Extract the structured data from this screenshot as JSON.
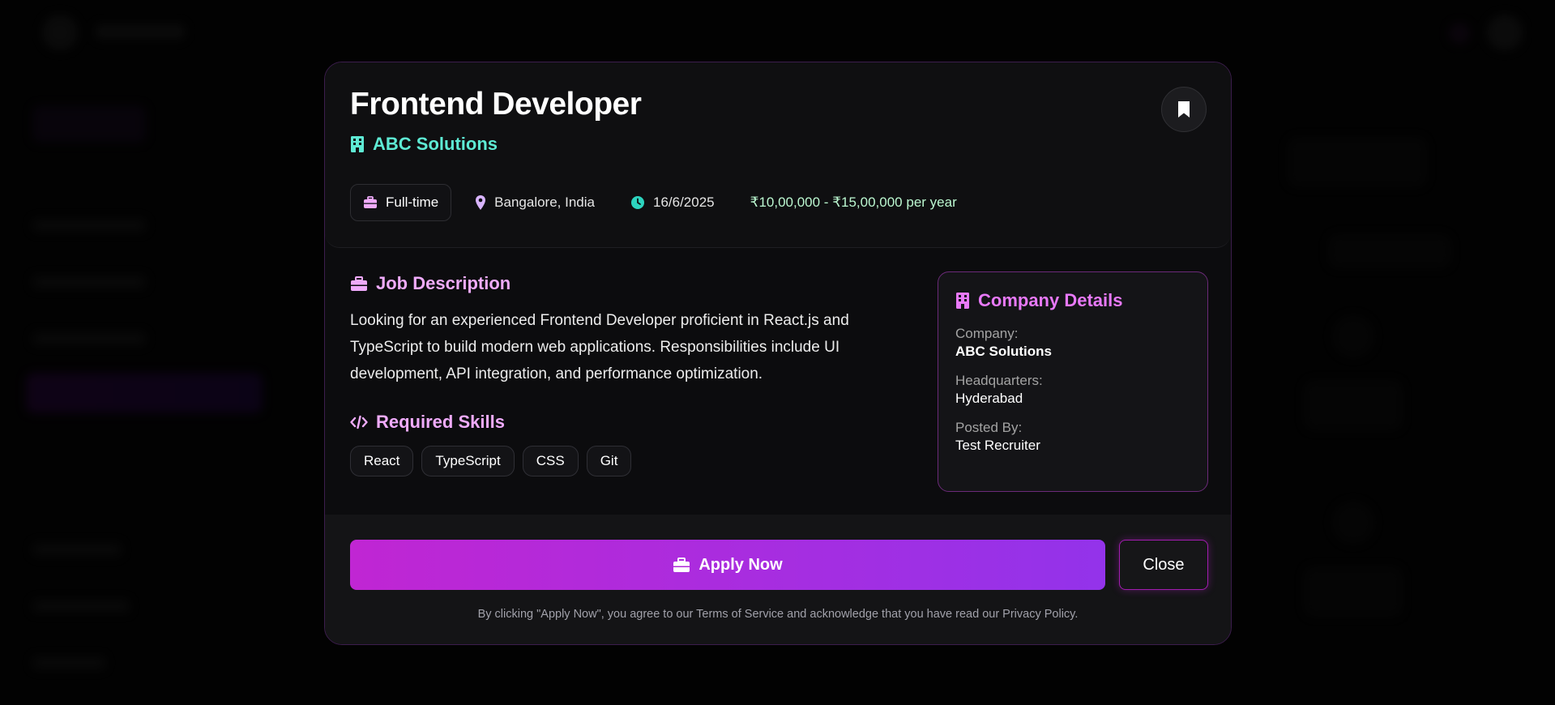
{
  "job": {
    "title": "Frontend Developer",
    "company": "ABC Solutions"
  },
  "meta": {
    "type": "Full-time",
    "location": "Bangalore, India",
    "date": "16/6/2025",
    "salary": "₹10,00,000 - ₹15,00,000 per year"
  },
  "description": {
    "heading": "Job Description",
    "text": "Looking for an experienced Frontend Developer proficient in React.js and TypeScript to build modern web applications. Responsibilities include UI development, API integration, and performance optimization."
  },
  "skills": {
    "heading": "Required Skills",
    "items": [
      "React",
      "TypeScript",
      "CSS",
      "Git"
    ]
  },
  "company_details": {
    "heading": "Company Details",
    "company_label": "Company:",
    "company_value": "ABC Solutions",
    "hq_label": "Headquarters:",
    "hq_value": "Hyderabad",
    "posted_label": "Posted By:",
    "posted_value": "Test Recruiter"
  },
  "footer": {
    "apply_label": "Apply Now",
    "close_label": "Close",
    "disclaimer": "By clicking \"Apply Now\", you agree to our Terms of Service and acknowledge that you have read our Privacy Policy."
  },
  "icons": {
    "bookmark": "bookmark-icon",
    "building": "building-icon",
    "briefcase": "briefcase-icon",
    "location": "map-pin-icon",
    "clock": "clock-icon",
    "code": "code-icon"
  },
  "colors": {
    "accent_teal": "#5eead4",
    "accent_pink": "#f0abfc",
    "accent_magenta": "#c026d3",
    "accent_purple": "#9333ea",
    "salary_green": "#bbf7d0"
  }
}
